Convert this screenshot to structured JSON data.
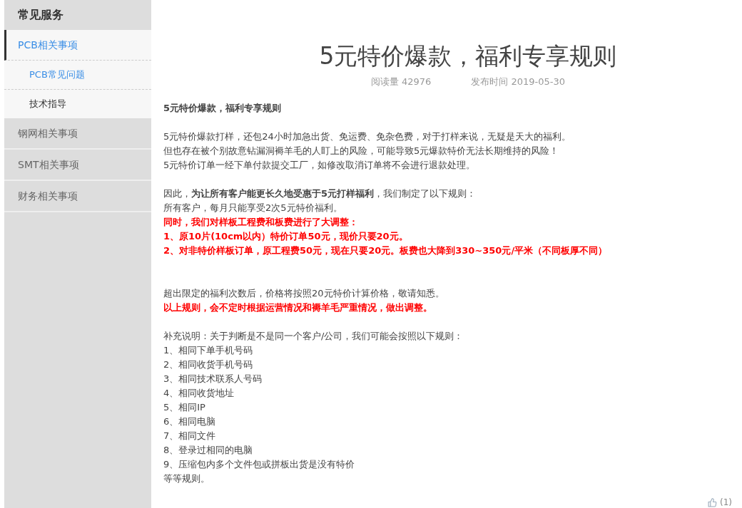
{
  "sidebar": {
    "title": "常见服务",
    "items": [
      {
        "label": "PCB相关事项",
        "selected": true,
        "children": [
          {
            "label": "PCB常见问题",
            "selected": true
          },
          {
            "label": "技术指导",
            "selected": false
          }
        ]
      },
      {
        "label": "钢网相关事项",
        "selected": false
      },
      {
        "label": "SMT相关事项",
        "selected": false
      },
      {
        "label": "财务相关事项",
        "selected": false
      }
    ]
  },
  "article": {
    "title": "5元特价爆款，福利专享规则",
    "views": "阅读量 42976",
    "published": "发布时间 2019-05-30",
    "paragraphs": [
      [
        {
          "kind": "bold",
          "text": "5元特价爆款，福利专享规则"
        }
      ],
      [
        {
          "kind": "plain",
          "text": "5元特价爆款打样，还包24小时加急出货、免运费、免杂色费，对于打样来说，无疑是天大的福利。"
        },
        {
          "kind": "plain",
          "text": "但也存在被个别故意钻漏洞褥羊毛的人盯上的风险，可能导致5元爆款特价无法长期维持的风险！"
        },
        {
          "kind": "plain",
          "text": "5元特价订单一经下单付款提交工厂，如修改取消订单将不会进行退款处理。"
        }
      ],
      [
        {
          "kind": "plain",
          "text": "因此，**为让所有客户能更长久地受惠于5元打样福利**，我们制定了以下规则："
        },
        {
          "kind": "plain",
          "text": "所有客户，每月只能享受2次5元特价福利。"
        },
        {
          "kind": "red",
          "text": "同时，我们对样板工程费和板费进行了大调整："
        },
        {
          "kind": "red",
          "text": "1、原10片(10cm以内）特价订单50元，现价只要20元。"
        },
        {
          "kind": "red",
          "text": "2、对非特价样板订单，原工程费50元，现在只要20元。板费也大降到330~350元/平米（不同板厚不同）"
        }
      ],
      [
        {
          "kind": "plain",
          "text": "超出限定的福利次数后，价格将按照20元特价计算价格，敬请知悉。"
        },
        {
          "kind": "red",
          "text": "以上规则，会不定时根据运营情况和褥羊毛严重情况，做出调整。"
        }
      ],
      [
        {
          "kind": "plain",
          "text": "补充说明：关于判断是不是同一个客户/公司，我们可能会按照以下规则："
        },
        {
          "kind": "plain",
          "text": "1、相同下单手机号码"
        },
        {
          "kind": "plain",
          "text": "2、相同收货手机号码"
        },
        {
          "kind": "plain",
          "text": "3、相同技术联系人号码"
        },
        {
          "kind": "plain",
          "text": "4、相同收货地址"
        },
        {
          "kind": "plain",
          "text": "5、相同IP"
        },
        {
          "kind": "plain",
          "text": "6、相同电脑"
        },
        {
          "kind": "plain",
          "text": "7、相同文件"
        },
        {
          "kind": "plain",
          "text": "8、登录过相同的电脑"
        },
        {
          "kind": "plain",
          "text": "9、压缩包内多个文件包或拼板出货是没有特价"
        },
        {
          "kind": "plain",
          "text": "等等规则。"
        }
      ]
    ],
    "likes": "(1)"
  }
}
